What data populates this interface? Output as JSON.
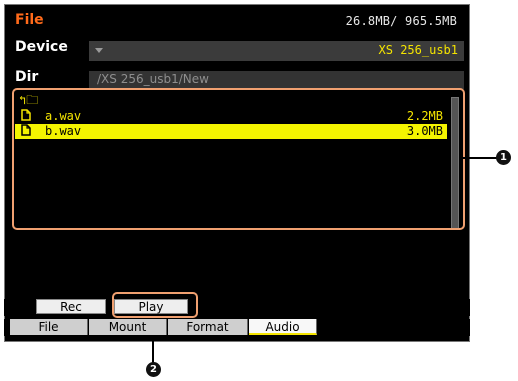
{
  "header": {
    "title": "File",
    "storage": "26.8MB/ 965.5MB"
  },
  "device": {
    "label": "Device",
    "value": "XS 256_usb1"
  },
  "dir": {
    "label": "Dir",
    "path": "/XS 256_usb1/New"
  },
  "file_list": {
    "up_icon": "↰🗀",
    "files": [
      {
        "icon": "file-icon",
        "name": "a.wav",
        "size": "2.2MB",
        "selected": false
      },
      {
        "icon": "file-icon",
        "name": "b.wav",
        "size": "3.0MB",
        "selected": true
      }
    ]
  },
  "buttons": {
    "rec": "Rec",
    "play": "Play"
  },
  "tabs": [
    "File",
    "Mount",
    "Format",
    "Audio"
  ],
  "active_tab": "Audio",
  "callouts": [
    "1",
    "2"
  ],
  "colors": {
    "accent_orange": "#ff6a1a",
    "highlight_yellow": "#f4e400",
    "callout": "#f0a070"
  }
}
